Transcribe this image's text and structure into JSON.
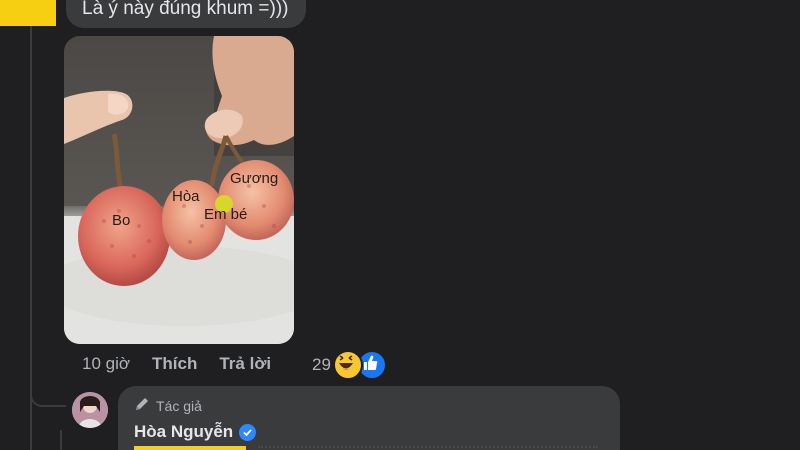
{
  "previous_comment": {
    "text": "Là ý này đúng khum =)))"
  },
  "photo": {
    "labels": {
      "bo": "Bo",
      "hoa": "Hòa",
      "guong": "Gương",
      "em_be": "Em bé"
    }
  },
  "comment_actions": {
    "time": "10 giờ",
    "like_label": "Thích",
    "reply_label": "Trả lời",
    "reaction_count": "29",
    "reactions": [
      "haha-icon",
      "like-icon"
    ]
  },
  "reply": {
    "author_tag": "Tác giả",
    "author_name": "Hòa Nguyễn",
    "verified": true
  },
  "colors": {
    "background": "#1f1f21",
    "bubble": "#3a3b3d",
    "redaction": "#f6cf12",
    "verified_badge": "#2d88ff",
    "like_reaction": "#1877f2"
  }
}
